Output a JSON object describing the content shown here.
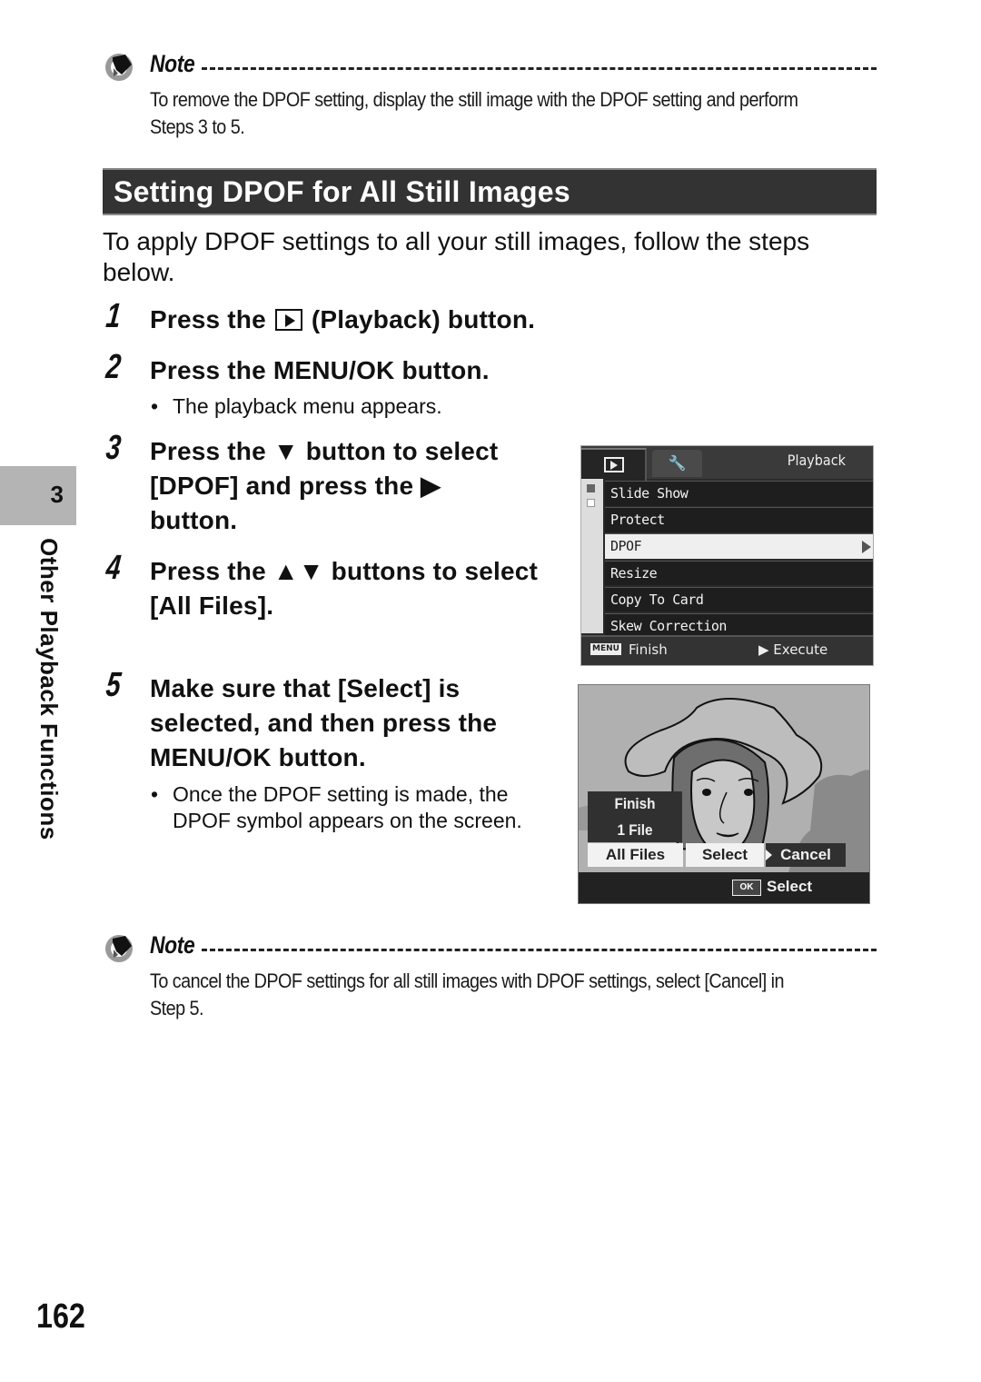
{
  "note_top": {
    "title": "Note",
    "text_line1": "To remove the DPOF setting, display the still image with the DPOF setting and perform",
    "text_line2": "Steps 3 to 5."
  },
  "section": {
    "title": "Setting DPOF for All Still Images",
    "intro_line1": "To apply DPOF settings to all your still images, follow the steps",
    "intro_line2": "below."
  },
  "steps": [
    {
      "number": "1",
      "text_before": "Press the",
      "icon": "playback-icon",
      "text_after": "(Playback) button."
    },
    {
      "number": "2",
      "text": "Press the MENU/OK button.",
      "bullet": "The playback menu appears."
    },
    {
      "number": "3",
      "line1": "Press the ▼ button to select",
      "line2": "[DPOF] and press the ▶",
      "line3": "button."
    },
    {
      "number": "4",
      "line1": "Press the ▲▼ buttons to select",
      "line2": "[All Files]."
    },
    {
      "number": "5",
      "line1": "Make sure that [Select] is",
      "line2": "selected, and then press the",
      "line3": "MENU/OK button.",
      "bullet_line1": "Once the DPOF setting is made, the",
      "bullet_line2": "DPOF symbol appears on the screen."
    }
  ],
  "side_tab": {
    "chapter_number": "3",
    "chapter_title": "Other Playback Functions"
  },
  "camera_menu": {
    "tab_playback_icon": "playback-icon",
    "tab_setup_icon": "wrench-icon",
    "title": "Playback",
    "items": [
      {
        "label": "Slide Show",
        "selected": false
      },
      {
        "label": "Protect",
        "selected": false
      },
      {
        "label": "DPOF",
        "selected": true
      },
      {
        "label": "Resize",
        "selected": false
      },
      {
        "label": "Copy To Card",
        "selected": false
      },
      {
        "label": "Skew Correction",
        "selected": false
      }
    ],
    "footer_key": "MENU",
    "footer_finish": "Finish",
    "footer_execute": "▶ Execute"
  },
  "camera_dpof": {
    "options": [
      "Finish",
      "1 File",
      "All Files"
    ],
    "selected_option": "All Files",
    "sub_options": [
      "Select",
      "Cancel"
    ],
    "selected_sub_option": "Select",
    "ok_key": "OK",
    "ok_label": "Select"
  },
  "note_bottom": {
    "title": "Note",
    "text_line1": "To cancel the DPOF settings for all still images with DPOF settings, select [Cancel] in",
    "text_line2": "Step 5."
  },
  "page_number": "162"
}
